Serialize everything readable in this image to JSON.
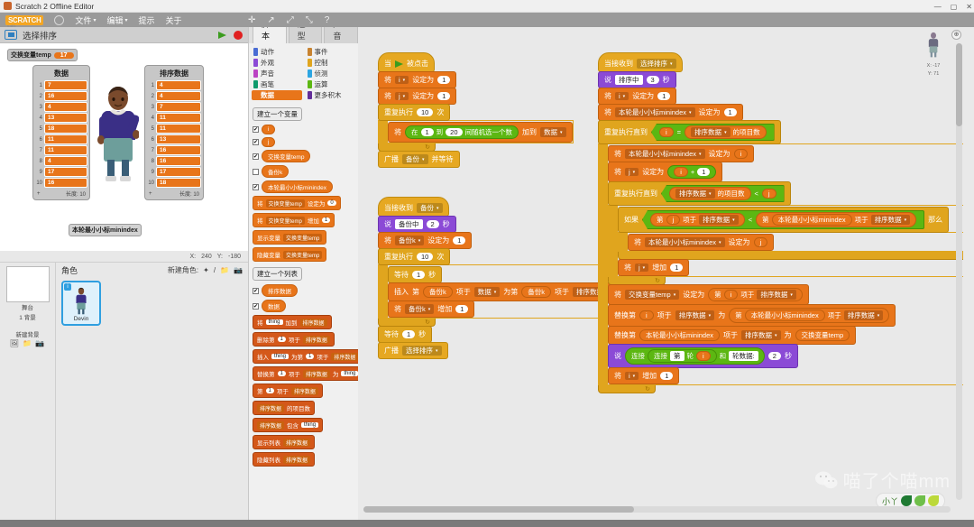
{
  "window": {
    "title": "Scratch 2 Offline Editor",
    "app_icon": "scratch-cat-icon",
    "minimize": "—",
    "maximize": "▢",
    "close": "✕"
  },
  "menubar": {
    "logo": "SCRATCH",
    "version_sub": "v.461",
    "globe_icon": "globe-icon",
    "items": [
      {
        "label": "文件",
        "caret": "▾"
      },
      {
        "label": "编辑",
        "caret": "▾"
      },
      {
        "label": "提示",
        "caret": ""
      },
      {
        "label": "关于",
        "caret": ""
      }
    ],
    "tools": [
      "✛",
      "↗",
      "✂",
      "⤢",
      "⤡",
      "?"
    ]
  },
  "stage": {
    "fullscreen_icon": "fullscreen-icon",
    "project_title": "选择排序",
    "green_flag": "green-flag-icon",
    "stop_button": "stop-sign-icon",
    "watcher": {
      "name": "交换变量temp",
      "value": "17"
    },
    "sprite_name": "Devin",
    "lists": [
      {
        "title": "数据",
        "items": [
          "7",
          "16",
          "4",
          "13",
          "18",
          "11",
          "11",
          "4",
          "17",
          "16"
        ],
        "footer_left": "+",
        "footer_right": "长度: 10"
      },
      {
        "title": "排序数据",
        "items": [
          "4",
          "4",
          "7",
          "11",
          "11",
          "13",
          "16",
          "16",
          "17",
          "18"
        ],
        "footer_left": "+",
        "footer_right": "长度: 10"
      }
    ],
    "mini_watcher": {
      "name": "本轮最小小标minindex",
      "value": ""
    },
    "coords": {
      "x_label": "X:",
      "x": "240",
      "y_label": "Y:",
      "y": "-180"
    }
  },
  "sprite_pane": {
    "stage_label": "舞台",
    "stage_sub": "1 背景",
    "new_backdrop_label": "新建背景",
    "new_backdrop_icons": [
      "🖼",
      "/",
      "📁",
      "📷"
    ],
    "header": "角色",
    "new_sprite_label": "新建角色:",
    "new_sprite_icons": [
      "✦",
      "/",
      "📁",
      "📷"
    ],
    "sprites": [
      {
        "name": "Devin",
        "info_badge": "i"
      }
    ]
  },
  "palette": {
    "tabs": [
      {
        "label": "脚本",
        "active": true
      },
      {
        "label": "造型",
        "active": false
      },
      {
        "label": "声音",
        "active": false
      }
    ],
    "categories": [
      {
        "label": "动作",
        "color": "#4a6cd4",
        "active": false
      },
      {
        "label": "事件",
        "color": "#c88330",
        "active": false
      },
      {
        "label": "外观",
        "color": "#8b4ad6",
        "active": false
      },
      {
        "label": "控制",
        "color": "#e0a51e",
        "active": false
      },
      {
        "label": "声音",
        "color": "#bb42c3",
        "active": false
      },
      {
        "label": "侦测",
        "color": "#2ca5e2",
        "active": false
      },
      {
        "label": "画笔",
        "color": "#0e9a6c",
        "active": false
      },
      {
        "label": "运算",
        "color": "#5cb712",
        "active": false
      },
      {
        "label": "数据",
        "color": "#e8751a",
        "active": true
      },
      {
        "label": "更多积木",
        "color": "#632d99",
        "active": false
      }
    ],
    "make_variable_button": "建立一个变量",
    "variables": [
      {
        "name": "i",
        "checked": true
      },
      {
        "name": "j",
        "checked": true
      },
      {
        "name": "交换变量temp",
        "checked": true
      },
      {
        "name": "备份k",
        "checked": false
      },
      {
        "name": "本轮最小小标minindex",
        "checked": true
      }
    ],
    "variable_blocks": [
      {
        "parts": [
          "将",
          "交换变量temp",
          "设定为",
          "0"
        ]
      },
      {
        "parts": [
          "将",
          "交换变量temp",
          "增加",
          "1"
        ]
      },
      {
        "parts": [
          "显示变量",
          "交换变量temp"
        ]
      },
      {
        "parts": [
          "隐藏变量",
          "交换变量temp"
        ]
      }
    ],
    "make_list_button": "建立一个列表",
    "lists": [
      {
        "name": "排序数据",
        "checked": true
      },
      {
        "name": "数据",
        "checked": true
      }
    ],
    "list_blocks": [
      {
        "parts": [
          "将",
          "thing",
          "加到",
          "排序数据"
        ]
      },
      {
        "parts": [
          "删除第",
          "1",
          "项于",
          "排序数据"
        ]
      },
      {
        "parts": [
          "插入",
          "thing",
          "为第",
          "1",
          "项于",
          "排序数据"
        ]
      },
      {
        "parts": [
          "替换第",
          "1",
          "项于",
          "排序数据",
          "为",
          "thing"
        ]
      },
      {
        "parts": [
          "第",
          "1",
          "项于",
          "排序数据"
        ]
      },
      {
        "parts": [
          "排序数据",
          "的项目数"
        ]
      },
      {
        "parts": [
          "排序数据",
          "包含",
          "thing"
        ]
      },
      {
        "parts": [
          "显示列表",
          "排序数据"
        ]
      },
      {
        "parts": [
          "隐藏列表",
          "排序数据"
        ]
      }
    ]
  },
  "canvas": {
    "sprite_info": {
      "x_label": "X:",
      "x": "-17",
      "y_label": "Y:",
      "y": "71"
    },
    "zoom_icon": "zoom-icon",
    "watermark": {
      "wechat_icon": "wechat-icon",
      "text": "喵了个喵mm"
    }
  },
  "scripts": {
    "setup": {
      "hat": {
        "pre": "当",
        "flag": "green-flag-icon",
        "post": "被点击"
      },
      "rows": [
        {
          "type": "dat",
          "parts": [
            "将",
            "@i",
            "设定为",
            "#1"
          ]
        },
        {
          "type": "dat",
          "parts": [
            "将",
            "@j",
            "设定为",
            "#1"
          ]
        }
      ],
      "repeat_label": "重复执行",
      "repeat_count": "10",
      "repeat_suffix": "次",
      "repeat_body": {
        "pre": "将",
        "rand_pre": "在",
        "rand_from": "1",
        "rand_mid": "到",
        "rand_to": "20",
        "rand_post": "间随机选一个数",
        "add_label": "加到",
        "list": "数据"
      },
      "broadcast": {
        "label": "广播",
        "msg": "备份",
        "suffix": "并等待"
      }
    },
    "backup": {
      "hat": {
        "pre": "当接收到",
        "msg": "备份"
      },
      "say": {
        "label": "说",
        "text": "备份中",
        "secs": "2",
        "unit": "秒"
      },
      "set_k": {
        "pre": "将",
        "var": "备份k",
        "mid": "设定为",
        "val": "1"
      },
      "repeat_label": "重复执行",
      "repeat_count": "10",
      "repeat_suffix": "次",
      "wait1": {
        "label": "等待",
        "secs": "1",
        "unit": "秒"
      },
      "insert": {
        "pre": "插入",
        "nth1": "第",
        "k1": "备份k",
        "of1": "项于",
        "list1": "数据",
        "mid": "为第",
        "nth2": "备份k",
        "of2": "项于",
        "list2": "排序数据"
      },
      "change_k": {
        "pre": "将",
        "var": "备份k",
        "mid": "增加",
        "val": "1"
      },
      "wait2": {
        "label": "等待",
        "secs": "1",
        "unit": "秒"
      },
      "broadcast": {
        "label": "广播",
        "msg": "选择排序"
      }
    },
    "sort": {
      "hat": {
        "pre": "当接收到",
        "msg": "选择排序"
      },
      "say": {
        "label": "说",
        "text": "排序中",
        "secs": "3",
        "unit": "秒"
      },
      "set_i": {
        "pre": "将",
        "var": "i",
        "mid": "设定为",
        "val": "1"
      },
      "set_min": {
        "pre": "将",
        "var": "本轮最小小标minindex",
        "mid": "设定为",
        "val": "1"
      },
      "outer": {
        "label": "重复执行直到",
        "left": "i",
        "op": "=",
        "right_list": "排序数据",
        "right_suffix": "的项目数"
      },
      "set_min2": {
        "pre": "将",
        "var": "本轮最小小标minindex",
        "mid": "设定为",
        "val": "i"
      },
      "set_j": {
        "pre": "将",
        "var": "j",
        "mid": "设定为",
        "a": "i",
        "op": "+",
        "b": "1"
      },
      "inner": {
        "label": "重复执行直到",
        "left_list": "排序数据",
        "left_suffix": "的项目数",
        "op": "<",
        "right": "j"
      },
      "if": {
        "label": "如果",
        "a_pre": "第",
        "a_idx": "j",
        "a_of": "项于",
        "a_list": "排序数据",
        "op": "<",
        "b_pre": "第",
        "b_idx": "本轮最小小标minindex",
        "b_of": "项于",
        "b_list": "排序数据",
        "suffix": "那么"
      },
      "if_body": {
        "pre": "将",
        "var": "本轮最小小标minindex",
        "mid": "设定为",
        "val": "j"
      },
      "change_j": {
        "pre": "将",
        "var": "j",
        "mid": "增加",
        "val": "1"
      },
      "set_temp": {
        "pre": "将",
        "var": "交换变量temp",
        "mid": "设定为",
        "nth": "第",
        "idx": "i",
        "of": "项于",
        "list": "排序数据"
      },
      "replace1": {
        "pre": "替换第",
        "idx": "i",
        "of": "项于",
        "list": "排序数据",
        "mid": "为",
        "nth2": "第",
        "idx2": "本轮最小小标minindex",
        "of2": "项于",
        "list2": "排序数据"
      },
      "replace2": {
        "pre": "替换第",
        "idx": "本轮最小小标minindex",
        "of": "项于",
        "list": "排序数据",
        "mid": "为",
        "val": "交换变量temp"
      },
      "say2": {
        "label": "说",
        "join1": "连接",
        "join2": "连接",
        "t1": "第",
        "t2": "轮",
        "v": "i",
        "and": "和",
        "t3": "轮数据:",
        "secs": "2",
        "unit": "秒"
      },
      "change_i": {
        "pre": "将",
        "var": "i",
        "mid": "增加",
        "val": "1"
      }
    }
  },
  "colors": {
    "data_orange": "#e8751a",
    "control_yellow": "#e0a51e",
    "events_gold": "#e6a822",
    "looks_purple": "#8b4ad6",
    "operators_green": "#5cb712",
    "accent_blue": "#2f9fe0"
  }
}
